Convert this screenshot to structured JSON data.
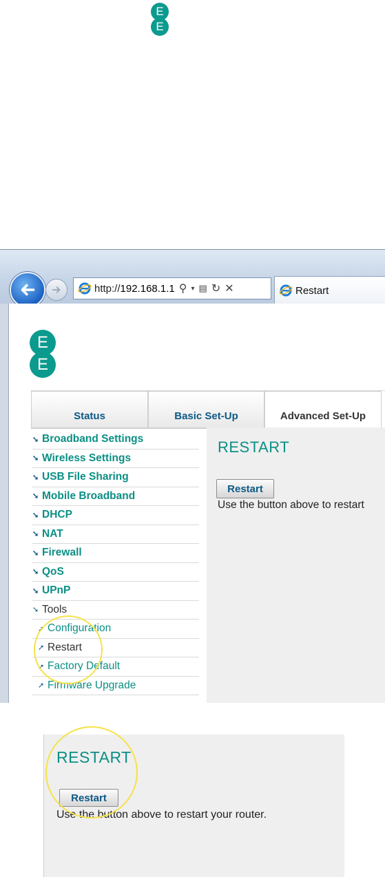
{
  "logo": {
    "letter_top": "E",
    "letter_bottom": "E"
  },
  "browser": {
    "address_prefix": "http://",
    "address_host": "192.168.1.1",
    "tab_title": "Restart"
  },
  "nav_tabs": [
    {
      "label": "Status"
    },
    {
      "label": "Basic Set-Up"
    },
    {
      "label": "Advanced Set-Up"
    }
  ],
  "sidebar": {
    "items": [
      {
        "label": "Broadband Settings"
      },
      {
        "label": "Wireless Settings"
      },
      {
        "label": "USB File Sharing"
      },
      {
        "label": "Mobile Broadband"
      },
      {
        "label": "DHCP"
      },
      {
        "label": "NAT"
      },
      {
        "label": "Firewall"
      },
      {
        "label": "QoS"
      },
      {
        "label": "UPnP"
      },
      {
        "label": "Tools"
      }
    ],
    "sub_items": [
      {
        "label": "Configuration"
      },
      {
        "label": "Restart"
      },
      {
        "label": "Factory Default"
      },
      {
        "label": "Firmware Upgrade"
      }
    ]
  },
  "panel": {
    "title": "RESTART",
    "button_label": "Restart",
    "description": "Use the button above to restart"
  },
  "zoom": {
    "title": "RESTART",
    "button_label": "Restart",
    "description": "Use the button above to restart your router."
  },
  "colors": {
    "ee_teal": "#0b9a8e",
    "link_blue": "#0d5a86",
    "highlight": "#f5e24a"
  }
}
